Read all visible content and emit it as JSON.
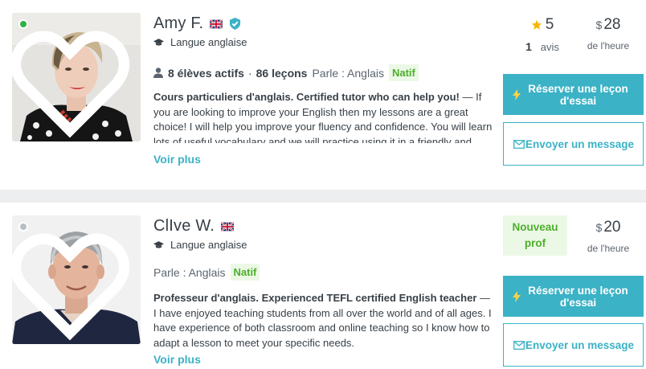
{
  "colors": {
    "accent": "#3bb2c6",
    "native_bg": "#ecf8e6",
    "native_fg": "#4caf2c",
    "star": "#f5b800",
    "online": "#2fb344"
  },
  "tutors": [
    {
      "name": "Amy F.",
      "flag_icon": "uk-flag-icon",
      "verified_icon": "verified-shield-icon",
      "status": "online",
      "subject": "Langue anglaise",
      "active_students": "8 élèves actifs",
      "separator": "·",
      "lessons": "86 leçons",
      "speaks_label": "Parle : Anglais",
      "native_label": "Natif",
      "description_bold": "Cours particuliers d'anglais. Certified tutor who can help you!",
      "description_rest": " — If you are looking to improve your English then my lessons are a great choice! I will help you improve your fluency and confidence. You will learn lots of useful vocabulary and we will practice using it in a friendly and productive",
      "see_more": "Voir plus",
      "rating": "5",
      "reviews_count": "1",
      "reviews_label": "avis",
      "currency": "$",
      "price": "28",
      "per_hour": "de l'heure",
      "book_label": "Réserver une leçon d'essai",
      "message_label": "Envoyer un message"
    },
    {
      "name": "ClIve W.",
      "flag_icon": "uk-flag-icon",
      "status": "offline",
      "subject": "Langue anglaise",
      "speaks_label": "Parle : Anglais",
      "native_label": "Natif",
      "new_badge": "Nouveau prof",
      "description_bold": "Professeur d'anglais. Experienced TEFL certified English teacher",
      "description_rest": " — I have enjoyed teaching students from all over the world and of all ages. I have experience of both classroom and online teaching so I know how to adapt a lesson to meet your specific needs.",
      "see_more": "Voir plus",
      "currency": "$",
      "price": "20",
      "per_hour": "de l'heure",
      "book_label": "Réserver une leçon d'essai",
      "message_label": "Envoyer un message"
    }
  ]
}
